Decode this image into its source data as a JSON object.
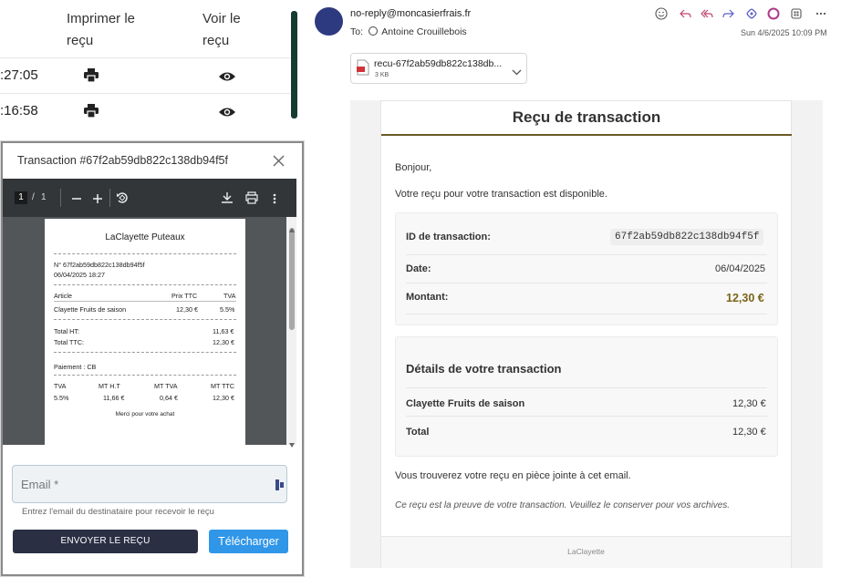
{
  "table": {
    "headers": [
      "Imprimer le\nreçu",
      "Voir le\nreçu"
    ],
    "header1_line1": "Imprimer le",
    "header1_line2": "reçu",
    "header2_line1": "Voir le",
    "header2_line2": "reçu",
    "rows": [
      {
        "time": ":27:05"
      },
      {
        "time": ":16:58"
      }
    ]
  },
  "modal": {
    "title": "Transaction #67f2ab59db822c138db94f5f",
    "pdf_toolbar": {
      "page_current": "1",
      "page_sep": "/",
      "page_total": "1"
    },
    "receipt": {
      "shop": "LaClayette Puteaux",
      "number": "N° 67f2ab59db822c138db94f5f",
      "datetime": "06/04/2025 18:27",
      "col_article": "Article",
      "col_price": "Prix TTC",
      "col_vat": "TVA",
      "item_name": "Clayette Fruits de saison",
      "item_price": "12,30 €",
      "item_vat": "5.5%",
      "total_ht_label": "Total HT:",
      "total_ht": "11,63 €",
      "total_ttc_label": "Total TTC:",
      "total_ttc": "12,30 €",
      "payment": "Paiement : CB",
      "vat_headers": [
        "TVA",
        "MT H.T",
        "MT TVA",
        "MT TTC"
      ],
      "vat_values": [
        "5.5%",
        "11,66 €",
        "0,64 €",
        "12,30 €"
      ],
      "thanks": "Merci pour votre achat"
    },
    "email_placeholder": "Email *",
    "email_help": "Entrez l'email du destinataire pour recevoir le reçu",
    "send_label": "ENVOYER LE REÇU",
    "download_label": "Télécharger"
  },
  "email": {
    "from": "no-reply@moncasierfrais.fr",
    "to_label": "To:",
    "to": "Antoine Crouillebois",
    "date": "Sun 4/6/2025 10:09 PM",
    "attachment_name": "recu-67f2ab59db822c138db...",
    "attachment_size": "3 KB",
    "title": "Reçu de transaction",
    "greeting": "Bonjour,",
    "intro": "Votre reçu pour votre transaction est disponible.",
    "id_label": "ID de transaction:",
    "id_value": "67f2ab59db822c138db94f5f",
    "date_label": "Date:",
    "date_value": "06/04/2025",
    "amount_label": "Montant:",
    "amount_value": "12,30 €",
    "details_title": "Détails de votre transaction",
    "item_name": "Clayette Fruits de saison",
    "item_price": "12,30 €",
    "total_label": "Total",
    "total_value": "12,30 €",
    "attached_note": "Vous trouverez votre reçu en pièce jointe à cet email.",
    "proof_note": "Ce reçu est la preuve de votre transaction. Veuillez le conserver pour vos archives.",
    "footer": "LaClayette",
    "colors": {
      "accent": "#6b5a23",
      "amount": "#7a6418",
      "avatar": "#2e3a80"
    }
  },
  "icons": [
    "print-icon",
    "eye-icon",
    "close-icon",
    "zoom-out-icon",
    "zoom-in-icon",
    "rotate-icon",
    "download-icon",
    "printer-icon",
    "more-icon",
    "emoji-icon",
    "reply-icon",
    "reply-all-icon",
    "forward-icon",
    "loop-icon",
    "copilot-icon",
    "apps-icon",
    "more-horizontal-icon",
    "pdf-file-icon",
    "chevron-down-icon",
    "attachment-field-icon"
  ]
}
